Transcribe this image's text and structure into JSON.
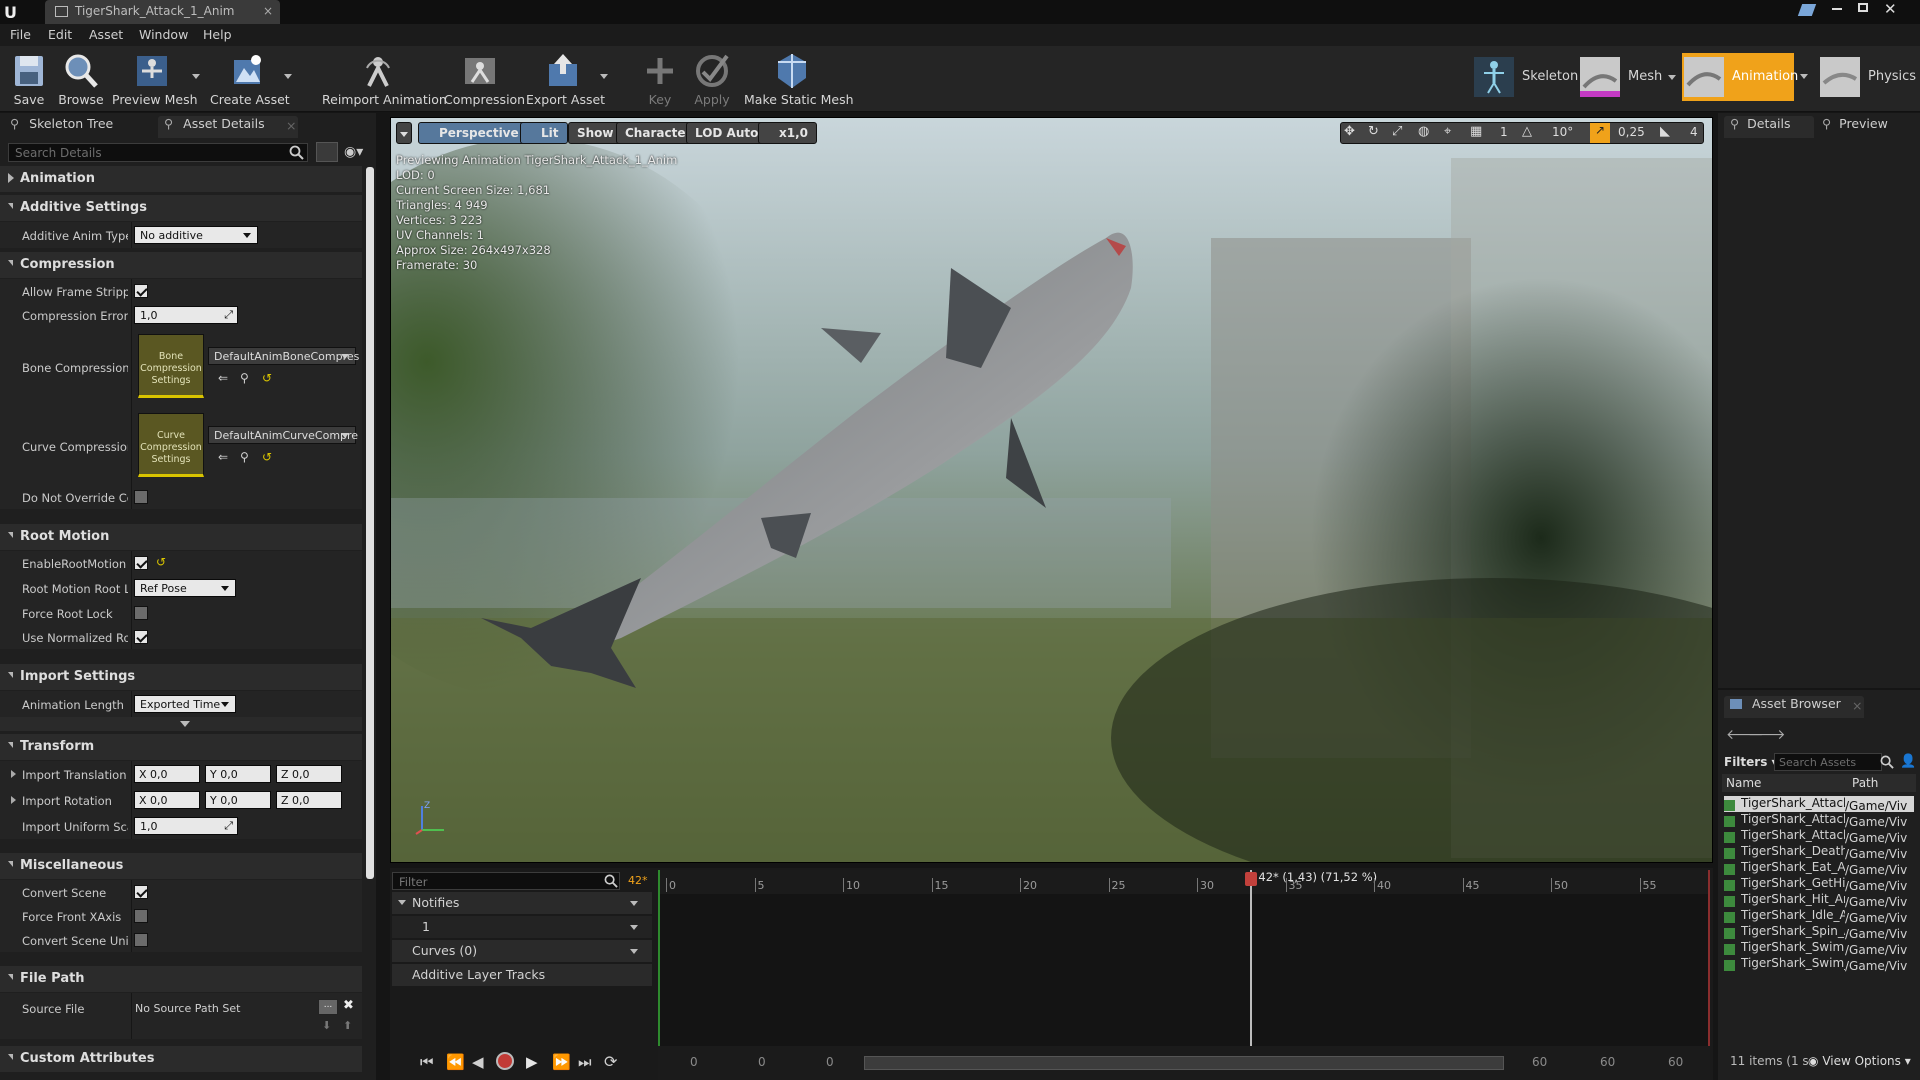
{
  "window": {
    "tab_title": "TigerShark_Attack_1_Anim"
  },
  "menu": [
    "File",
    "Edit",
    "Asset",
    "Window",
    "Help"
  ],
  "toolbar": [
    {
      "label": "Save",
      "icon": "save-icon"
    },
    {
      "label": "Browse",
      "icon": "browse-icon"
    },
    {
      "label": "Preview Mesh",
      "icon": "preview-mesh-icon"
    },
    {
      "label": "Create Asset",
      "icon": "create-asset-icon"
    },
    {
      "label": "Reimport Animation",
      "icon": "reimport-icon"
    },
    {
      "label": "Compression",
      "icon": "compression-icon"
    },
    {
      "label": "Export Asset",
      "icon": "export-icon"
    },
    {
      "label": "Key",
      "icon": "key-icon"
    },
    {
      "label": "Apply",
      "icon": "apply-icon"
    },
    {
      "label": "Make Static Mesh",
      "icon": "static-mesh-icon"
    }
  ],
  "modes": [
    {
      "label": "Skeleton",
      "active": false
    },
    {
      "label": "Mesh",
      "active": false
    },
    {
      "label": "Animation",
      "active": true
    },
    {
      "label": "Physics",
      "active": false
    }
  ],
  "left_tabs": [
    "Skeleton Tree",
    "Asset Details"
  ],
  "details": {
    "search_placeholder": "Search Details",
    "categories": {
      "animation": "Animation",
      "additive": "Additive Settings",
      "compression": "Compression",
      "root_motion": "Root Motion",
      "import": "Import Settings",
      "transform": "Transform",
      "misc": "Miscellaneous",
      "file_path": "File Path",
      "custom": "Custom Attributes"
    },
    "additive_anim_type": {
      "label": "Additive Anim Type",
      "value": "No additive"
    },
    "allow_frame_stripping": {
      "label": "Allow Frame Stripping",
      "checked": true
    },
    "compression_error": {
      "label": "Compression Error Th",
      "value": "1,0"
    },
    "bone_compression": {
      "label": "Bone Compression Se",
      "thumb": "Bone Compression Settings",
      "value": "DefaultAnimBoneCompres"
    },
    "curve_compression": {
      "label": "Curve Compression S",
      "thumb": "Curve Compression Settings",
      "value": "DefaultAnimCurveCompre"
    },
    "do_not_override": {
      "label": "Do Not Override Com",
      "checked": false
    },
    "enable_root_motion": {
      "label": "EnableRootMotion",
      "checked": true
    },
    "root_motion_root_lock": {
      "label": "Root Motion Root Loc",
      "value": "Ref Pose"
    },
    "force_root_lock": {
      "label": "Force Root Lock",
      "checked": false
    },
    "use_normalized_root": {
      "label": "Use Normalized Root",
      "checked": true
    },
    "animation_length": {
      "label": "Animation Length",
      "value": "Exported Time"
    },
    "import_translation": {
      "label": "Import Translation",
      "x": "0,0",
      "y": "0,0",
      "z": "0,0"
    },
    "import_rotation": {
      "label": "Import Rotation",
      "x": "0,0",
      "y": "0,0",
      "z": "0,0"
    },
    "import_uniform_scale": {
      "label": "Import Uniform Scale",
      "value": "1,0"
    },
    "convert_scene": {
      "label": "Convert Scene",
      "checked": true
    },
    "force_front_xaxis": {
      "label": "Force Front XAxis",
      "checked": false
    },
    "convert_scene_unit": {
      "label": "Convert Scene Unit",
      "checked": false
    },
    "source_file": {
      "label": "Source File",
      "value": "No Source Path Set"
    },
    "axis_x": "X",
    "axis_y": "Y",
    "axis_z": "Z"
  },
  "viewport": {
    "buttons": [
      "Perspective",
      "Lit",
      "Show",
      "Character",
      "LOD Auto",
      "x1,0"
    ],
    "snap_angle": "10°",
    "snap_scale": "0,25",
    "camera_speed": "4",
    "grid_count": "1",
    "stats": [
      "Previewing Animation TigerShark_Attack_1_Anim",
      "LOD: 0",
      "Current Screen Size: 1,681",
      "Triangles: 4 949",
      "Vertices: 3 223",
      "UV Channels: 1",
      "Approx Size: 264x497x328",
      "Framerate: 30"
    ]
  },
  "timeline": {
    "filter_placeholder": "Filter",
    "frame_badge": "42*",
    "tracks": {
      "notifies": "Notifies",
      "notify_row": "1",
      "curves": "Curves  (0)",
      "additive": "Additive Layer Tracks"
    },
    "ruler": [
      "0",
      "5",
      "10",
      "15",
      "20",
      "25",
      "30",
      "35",
      "40",
      "45",
      "50",
      "55"
    ],
    "playhead_label": "42* (1,43) (71,52 %)",
    "playhead_fraction": 0.7152,
    "range": {
      "start_a": "0",
      "start_b": "0",
      "start_c": "0",
      "end_a": "60",
      "end_b": "60",
      "end_c": "60"
    }
  },
  "right_tabs": [
    "Details",
    "Preview"
  ],
  "asset_browser": {
    "tab": "Asset Browser",
    "filters": "Filters",
    "search_placeholder": "Search Assets",
    "col_name": "Name",
    "col_path": "Path",
    "items": [
      {
        "name": "TigerShark_Attack_",
        "path": "/Game/Viv",
        "selected": true
      },
      {
        "name": "TigerShark_Attack_",
        "path": "/Game/Viv",
        "selected": false
      },
      {
        "name": "TigerShark_Attack_",
        "path": "/Game/Viv",
        "selected": false
      },
      {
        "name": "TigerShark_Death_",
        "path": "/Game/Viv",
        "selected": false
      },
      {
        "name": "TigerShark_Eat_An",
        "path": "/Game/Viv",
        "selected": false
      },
      {
        "name": "TigerShark_GetHit_",
        "path": "/Game/Viv",
        "selected": false
      },
      {
        "name": "TigerShark_Hit_Ani",
        "path": "/Game/Viv",
        "selected": false
      },
      {
        "name": "TigerShark_Idle_Ar",
        "path": "/Game/Viv",
        "selected": false
      },
      {
        "name": "TigerShark_Spin_A",
        "path": "/Game/Viv",
        "selected": false
      },
      {
        "name": "TigerShark_Swim2_",
        "path": "/Game/Viv",
        "selected": false
      },
      {
        "name": "TigerShark_Swim_A",
        "path": "/Game/Viv",
        "selected": false
      }
    ],
    "count": "11 items (1 s",
    "view_options": "View Options"
  },
  "colors": {
    "accent": "#f0a21a",
    "panel": "#1f1f1f",
    "selected_row": "#d6d6d6"
  }
}
